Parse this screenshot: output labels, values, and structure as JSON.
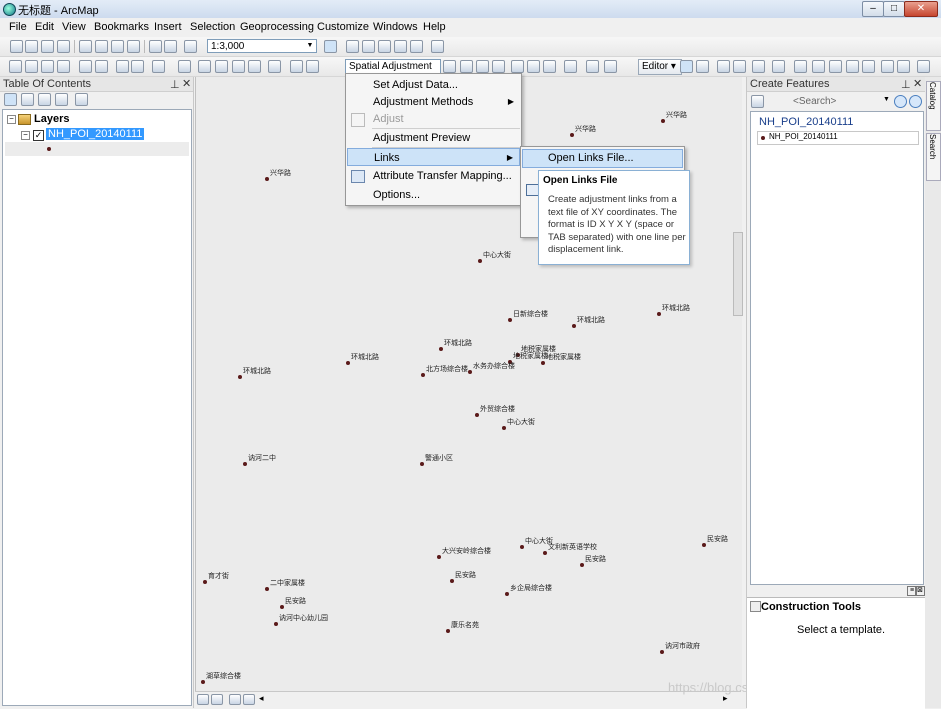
{
  "window": {
    "title": "无标题 - ArcMap"
  },
  "menubar": [
    "File",
    "Edit",
    "View",
    "Bookmarks",
    "Insert",
    "Selection",
    "Geoprocessing",
    "Customize",
    "Windows",
    "Help"
  ],
  "toolbar": {
    "scale": "1:3,000",
    "spatial_adjustment_label": "Spatial Adjustment",
    "editor_label": "Editor"
  },
  "toc": {
    "title": "Table Of Contents",
    "layers_label": "Layers",
    "layer_name": "NH_POI_20140111",
    "layer_checked": true
  },
  "spatial_menu": {
    "items": [
      {
        "label": "Set Adjust Data...",
        "enabled": true,
        "submenu": false
      },
      {
        "label": "Adjustment Methods",
        "enabled": true,
        "submenu": true
      },
      {
        "label": "Adjust",
        "enabled": false,
        "submenu": false
      },
      {
        "label": "Adjustment Preview",
        "enabled": true,
        "submenu": false
      },
      {
        "label": "Links",
        "enabled": true,
        "submenu": true,
        "highlighted": true
      },
      {
        "label": "Attribute Transfer Mapping...",
        "enabled": true,
        "submenu": false
      },
      {
        "label": "Options...",
        "enabled": true,
        "submenu": false
      }
    ]
  },
  "links_submenu": {
    "highlighted_item": "Open Links File..."
  },
  "tooltip": {
    "title": "Open Links File",
    "body": "Create adjustment links from a text file of XY coordinates. The format is ID X Y X Y (space or TAB separated) with one line per displacement link."
  },
  "map_labels": [
    "兴华路",
    "兴华路",
    "兴华路",
    "中心大街",
    "日新综合楼",
    "环城北路",
    "环城北路",
    "环城北路",
    "地税家属楼",
    "地税家属楼",
    "地税家属楼",
    "环城北路",
    "北方场综合楼",
    "水务办综合楼",
    "环城北路",
    "外贸综合楼",
    "中心大街",
    "讷河二中",
    "警通小区",
    "中心大街",
    "文利新英语学校",
    "民安路",
    "大兴安岭综合楼",
    "民安路",
    "乡企局综合楼",
    "育才街",
    "二中家属楼",
    "民安路",
    "讷河中心幼儿园",
    "康乐名苑",
    "讷河市政府",
    "湖草综合楼",
    "民安路"
  ],
  "create_features": {
    "title": "Create Features",
    "search_placeholder": "<Search>",
    "group_name": "NH_POI_20140111",
    "layer_name": "NH_POI_20140111"
  },
  "construction_tools": {
    "title": "Construction Tools",
    "hint": "Select a template."
  },
  "right_tabs": [
    "Catalog",
    "Search"
  ],
  "watermark": "https://blog.csdn.net/chengluizhenaza"
}
